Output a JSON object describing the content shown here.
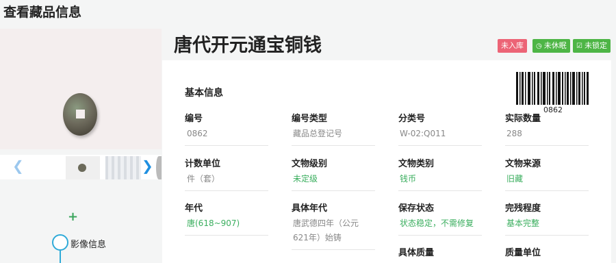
{
  "page": {
    "title": "查看藏品信息"
  },
  "gallery": {
    "prev_icon": "chevron-left-icon",
    "next_icon": "chevron-right-icon"
  },
  "add": {
    "icon": "plus-icon",
    "glyph": "+"
  },
  "steps": [
    {
      "label": "影像信息"
    }
  ],
  "relic": {
    "title": "唐代开元通宝铜钱"
  },
  "badges": [
    {
      "label": "未入库",
      "color": "#ec6476"
    },
    {
      "label": "未休眠",
      "icon": "clock-icon",
      "color": "#4db545"
    },
    {
      "label": "未锁定",
      "icon": "lock-icon",
      "color": "#4db545"
    }
  ],
  "basic_info": {
    "title": "基本信息",
    "barcode_number": "0862",
    "fields": [
      {
        "label": "编号",
        "value": "0862"
      },
      {
        "label": "编号类型",
        "value": "藏品总登记号"
      },
      {
        "label": "分类号",
        "value": "W-02:Q011"
      },
      {
        "label": "实际数量",
        "value": "288"
      },
      {
        "label": "计数单位",
        "value": "件（套）"
      },
      {
        "label": "文物级别",
        "value": "未定级"
      },
      {
        "label": "文物类别",
        "value": "钱币"
      },
      {
        "label": "文物来源",
        "value": "旧藏"
      },
      {
        "label": "年代",
        "value": "唐(618~907)"
      },
      {
        "label": "具体年代",
        "value": "唐武德四年（公元621年）始铸"
      },
      {
        "label": "保存状态",
        "value": "状态稳定，不需修复"
      },
      {
        "label": "完残程度",
        "value": "基本完整"
      },
      {
        "label": "具体质量",
        "value": ""
      },
      {
        "label": "质量单位",
        "value": ""
      }
    ]
  },
  "colors": {
    "accent_green": "#3aae5e",
    "badge_red": "#ec6476",
    "badge_green": "#4db545",
    "step_blue": "#2eaad8"
  }
}
